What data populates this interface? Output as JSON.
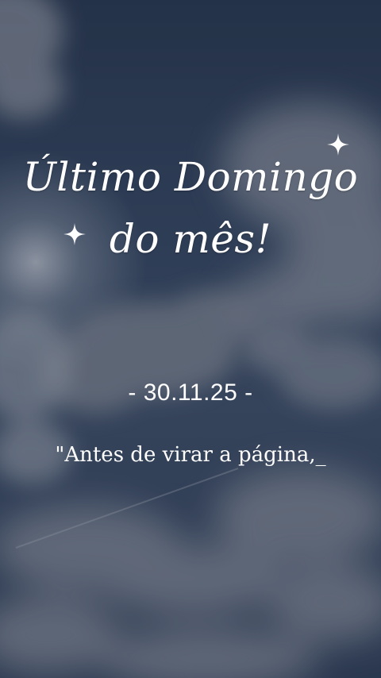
{
  "story": {
    "title_line_1": "Último Domingo",
    "title_line_2": "do mês!",
    "date": "- 30.11.25 -",
    "quote": "\"Antes de virar a página,_"
  },
  "icons": {
    "sparkle": "four-point-star-sparkle"
  },
  "colors": {
    "sky_top": "#27354c",
    "sky_mid": "#3b4a62",
    "cloud": "#8e949f",
    "text": "#ffffff"
  }
}
